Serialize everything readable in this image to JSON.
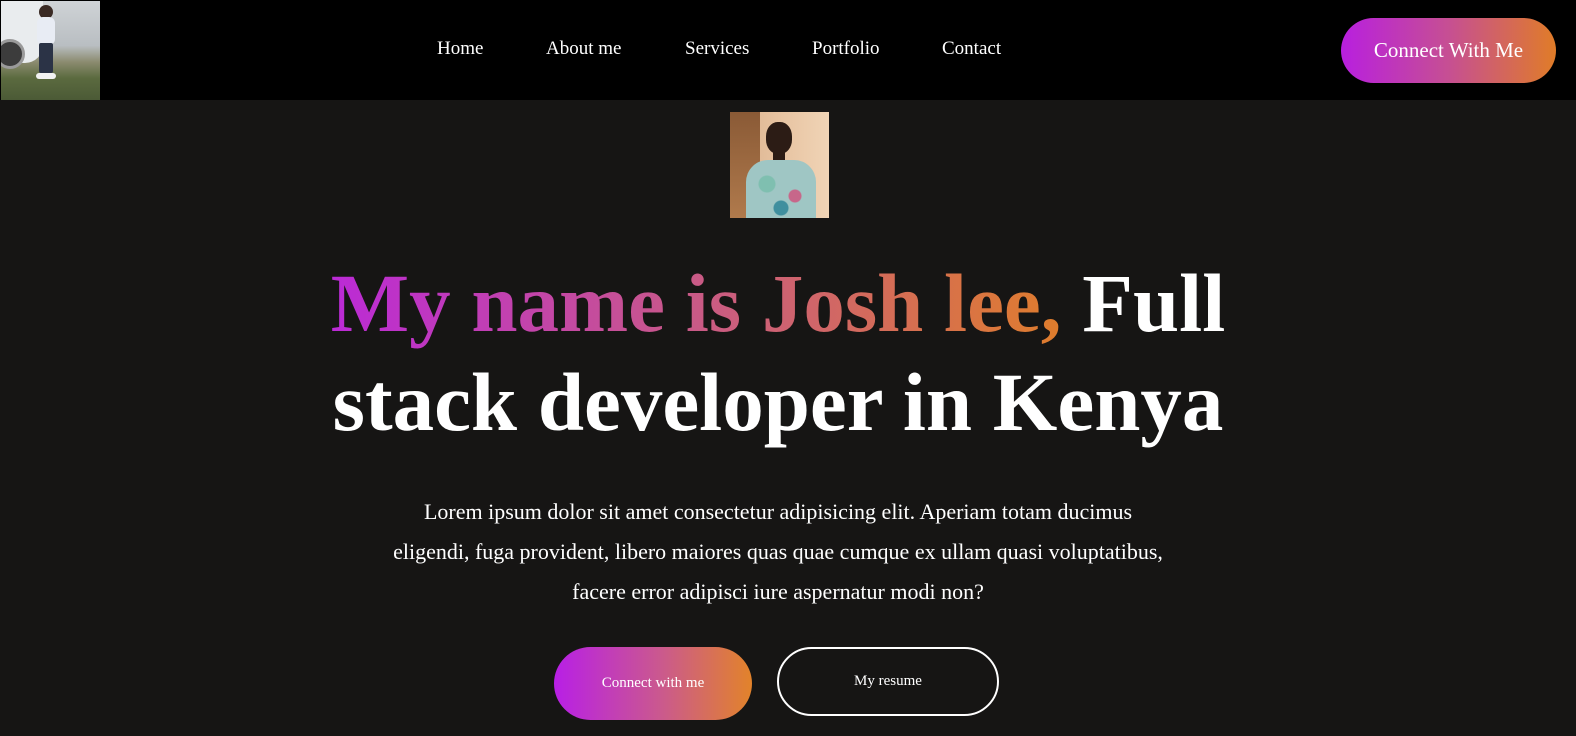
{
  "nav": {
    "links": [
      "Home",
      "About me",
      "Services",
      "Portfolio",
      "Contact"
    ],
    "cta_label": "Connect With Me"
  },
  "hero": {
    "headline_gradient": "My name is Josh lee,",
    "headline_rest_line1": "Full",
    "headline_line2": "stack developer in Kenya",
    "intro": "Lorem ipsum dolor sit amet consectetur adipisicing elit. Aperiam totam ducimus eligendi, fuga provident, libero maiores quas quae cumque ex ullam quasi voluptatibus, facere error adipisci iure aspernatur modi non?",
    "primary_button": "Connect with me",
    "secondary_button": "My resume"
  },
  "colors": {
    "background": "#161514",
    "navbar": "#000000",
    "gradient_start": "#b81fdf",
    "gradient_mid": "#c95a86",
    "gradient_end": "#e07c28",
    "text": "#ffffff"
  },
  "icons": {
    "logo": "logo-photo",
    "avatar": "profile-photo"
  }
}
